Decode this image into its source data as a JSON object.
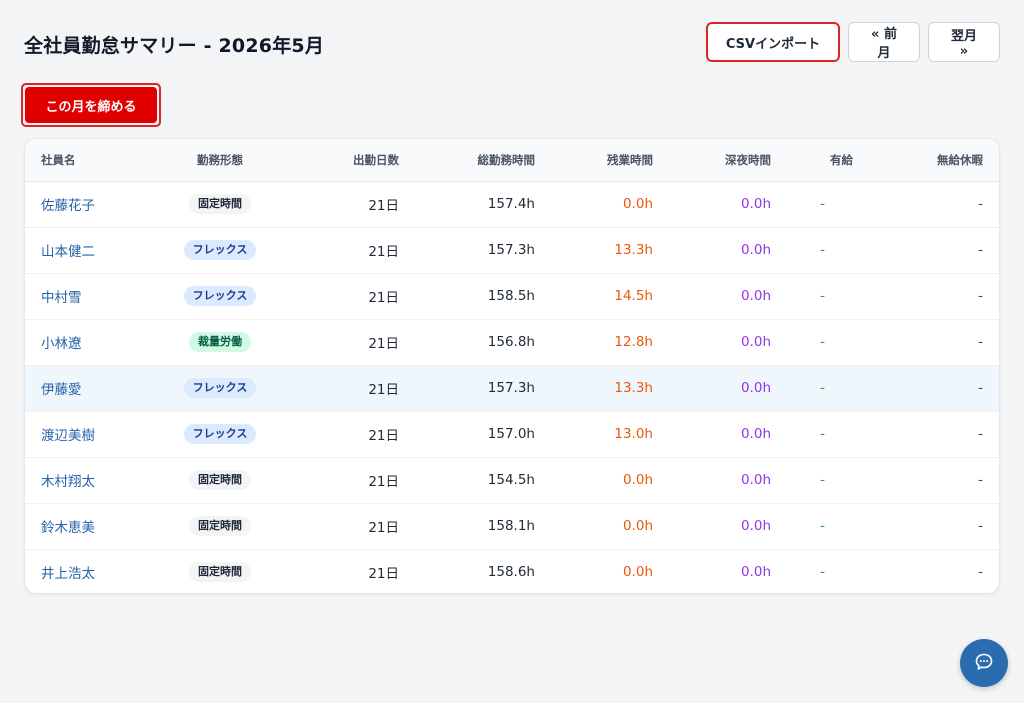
{
  "header": {
    "title": "全社員勤怠サマリー - 2026年5月",
    "csv_import": "CSVインポート",
    "prev_month": "« 前月",
    "next_month": "翌月 »"
  },
  "close_month_button": "この月を締める",
  "table": {
    "columns": [
      "社員名",
      "勤務形態",
      "出勤日数",
      "総勤務時間",
      "残業時間",
      "深夜時間",
      "有給",
      "無給休暇"
    ],
    "rows": [
      {
        "name": "佐藤花子",
        "type": "固定時間",
        "type_kind": "fixed",
        "days": "21日",
        "total": "157.4h",
        "overtime": "0.0h",
        "night": "0.0h",
        "paid": "-",
        "unpaid": "-"
      },
      {
        "name": "山本健二",
        "type": "フレックス",
        "type_kind": "flex",
        "days": "21日",
        "total": "157.3h",
        "overtime": "13.3h",
        "night": "0.0h",
        "paid": "-",
        "unpaid": "-"
      },
      {
        "name": "中村雪",
        "type": "フレックス",
        "type_kind": "flex",
        "days": "21日",
        "total": "158.5h",
        "overtime": "14.5h",
        "night": "0.0h",
        "paid": "-",
        "unpaid": "-"
      },
      {
        "name": "小林遼",
        "type": "裁量労働",
        "type_kind": "disc",
        "days": "21日",
        "total": "156.8h",
        "overtime": "12.8h",
        "night": "0.0h",
        "paid": "-",
        "unpaid": "-"
      },
      {
        "name": "伊藤愛",
        "type": "フレックス",
        "type_kind": "flex",
        "days": "21日",
        "total": "157.3h",
        "overtime": "13.3h",
        "night": "0.0h",
        "paid": "-",
        "unpaid": "-"
      },
      {
        "name": "渡辺美樹",
        "type": "フレックス",
        "type_kind": "flex",
        "days": "21日",
        "total": "157.0h",
        "overtime": "13.0h",
        "night": "0.0h",
        "paid": "-",
        "unpaid": "-"
      },
      {
        "name": "木村翔太",
        "type": "固定時間",
        "type_kind": "fixed",
        "days": "21日",
        "total": "154.5h",
        "overtime": "0.0h",
        "night": "0.0h",
        "paid": "-",
        "unpaid": "-"
      },
      {
        "name": "鈴木恵美",
        "type": "固定時間",
        "type_kind": "fixed",
        "days": "21日",
        "total": "158.1h",
        "overtime": "0.0h",
        "night": "0.0h",
        "paid": "-",
        "unpaid": "-"
      },
      {
        "name": "井上浩太",
        "type": "固定時間",
        "type_kind": "fixed",
        "days": "21日",
        "total": "158.6h",
        "overtime": "0.0h",
        "night": "0.0h",
        "paid": "-",
        "unpaid": "-"
      }
    ]
  },
  "chat_button_icon": "chat-bubble-icon",
  "colors": {
    "primary_red": "#e00000",
    "link_blue": "#2563a8",
    "overtime_orange": "#ea580c",
    "night_purple": "#9333ea",
    "paid_green": "#16a34a",
    "fab_blue": "#2b6cb0"
  }
}
